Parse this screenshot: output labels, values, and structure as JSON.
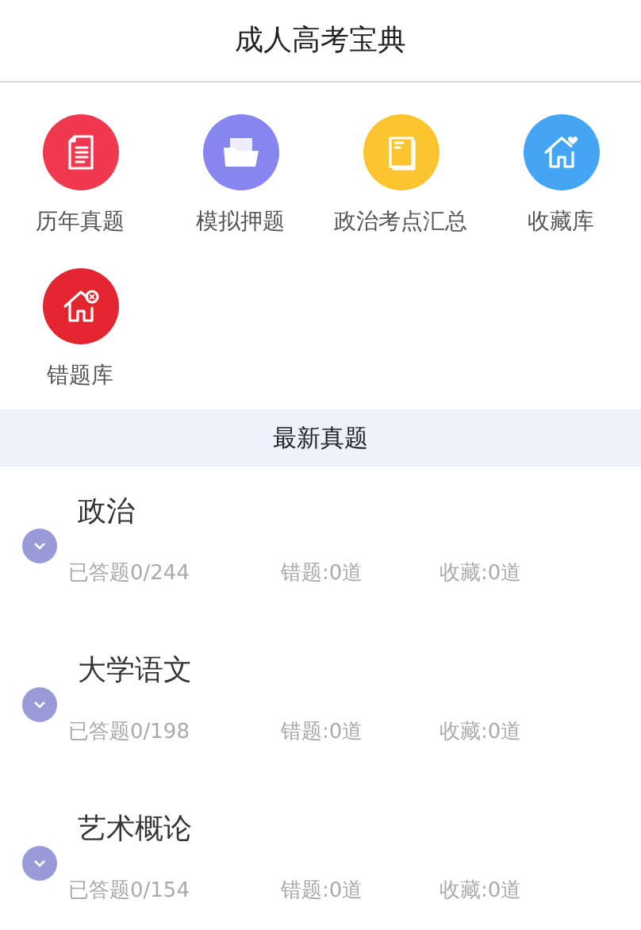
{
  "header": {
    "title": "成人高考宝典"
  },
  "menu": [
    {
      "label": "历年真题",
      "kind": "document",
      "color": "#f0384f"
    },
    {
      "label": "模拟押题",
      "kind": "folder",
      "color": "#8785f0"
    },
    {
      "label": "政治考点汇总",
      "kind": "book",
      "color": "#fcc530"
    },
    {
      "label": "收藏库",
      "kind": "house-heart",
      "color": "#45a5f5"
    },
    {
      "label": "错题库",
      "kind": "house-x",
      "color": "#e3252f"
    }
  ],
  "section": {
    "title": "最新真题"
  },
  "subjects": [
    {
      "name": "政治",
      "answered": "已答题0/244",
      "wrong": "错题:0道",
      "favorites": "收藏:0道"
    },
    {
      "name": "大学语文",
      "answered": "已答题0/198",
      "wrong": "错题:0道",
      "favorites": "收藏:0道"
    },
    {
      "name": "艺术概论",
      "answered": "已答题0/154",
      "wrong": "错题:0道",
      "favorites": "收藏:0道"
    }
  ]
}
